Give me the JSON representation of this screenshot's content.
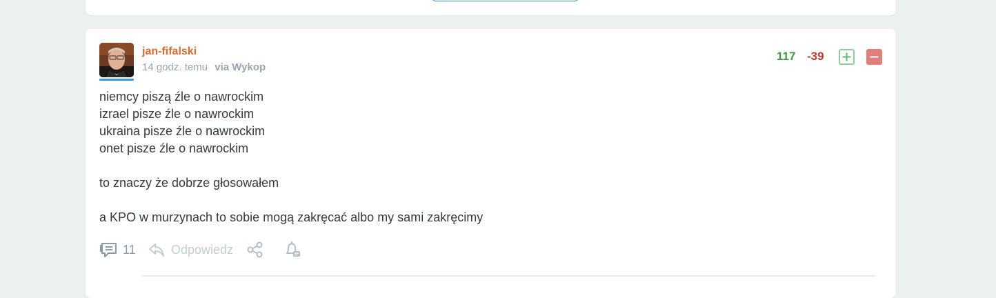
{
  "previous_card": {},
  "entry": {
    "author": "jan-fifalski",
    "time": "14 godz. temu",
    "via": "via Wykop",
    "votes": {
      "plus": "117",
      "minus": "-39"
    },
    "body_lines": [
      "niemcy piszą źle o nawrockim",
      "izrael pisze źle o nawrockim",
      "ukraina pisze źle o nawrockim",
      "onet pisze źle o nawrockim",
      "",
      "to znaczy że dobrze głosowałem",
      "",
      "a KPO w murzynach to sobie mogą zakręcać albo my sami zakręcimy"
    ],
    "actions": {
      "comments_count": "11",
      "reply_label": "Odpowiedz"
    }
  },
  "colors": {
    "author": "#e16b2c",
    "plus": "#3d9b3f",
    "minus": "#c0392b",
    "accent": "#3c96d7"
  },
  "icons": [
    "comments-icon",
    "reply-icon",
    "share-icon",
    "notify-bell-icon",
    "plus-icon",
    "minus-icon"
  ]
}
